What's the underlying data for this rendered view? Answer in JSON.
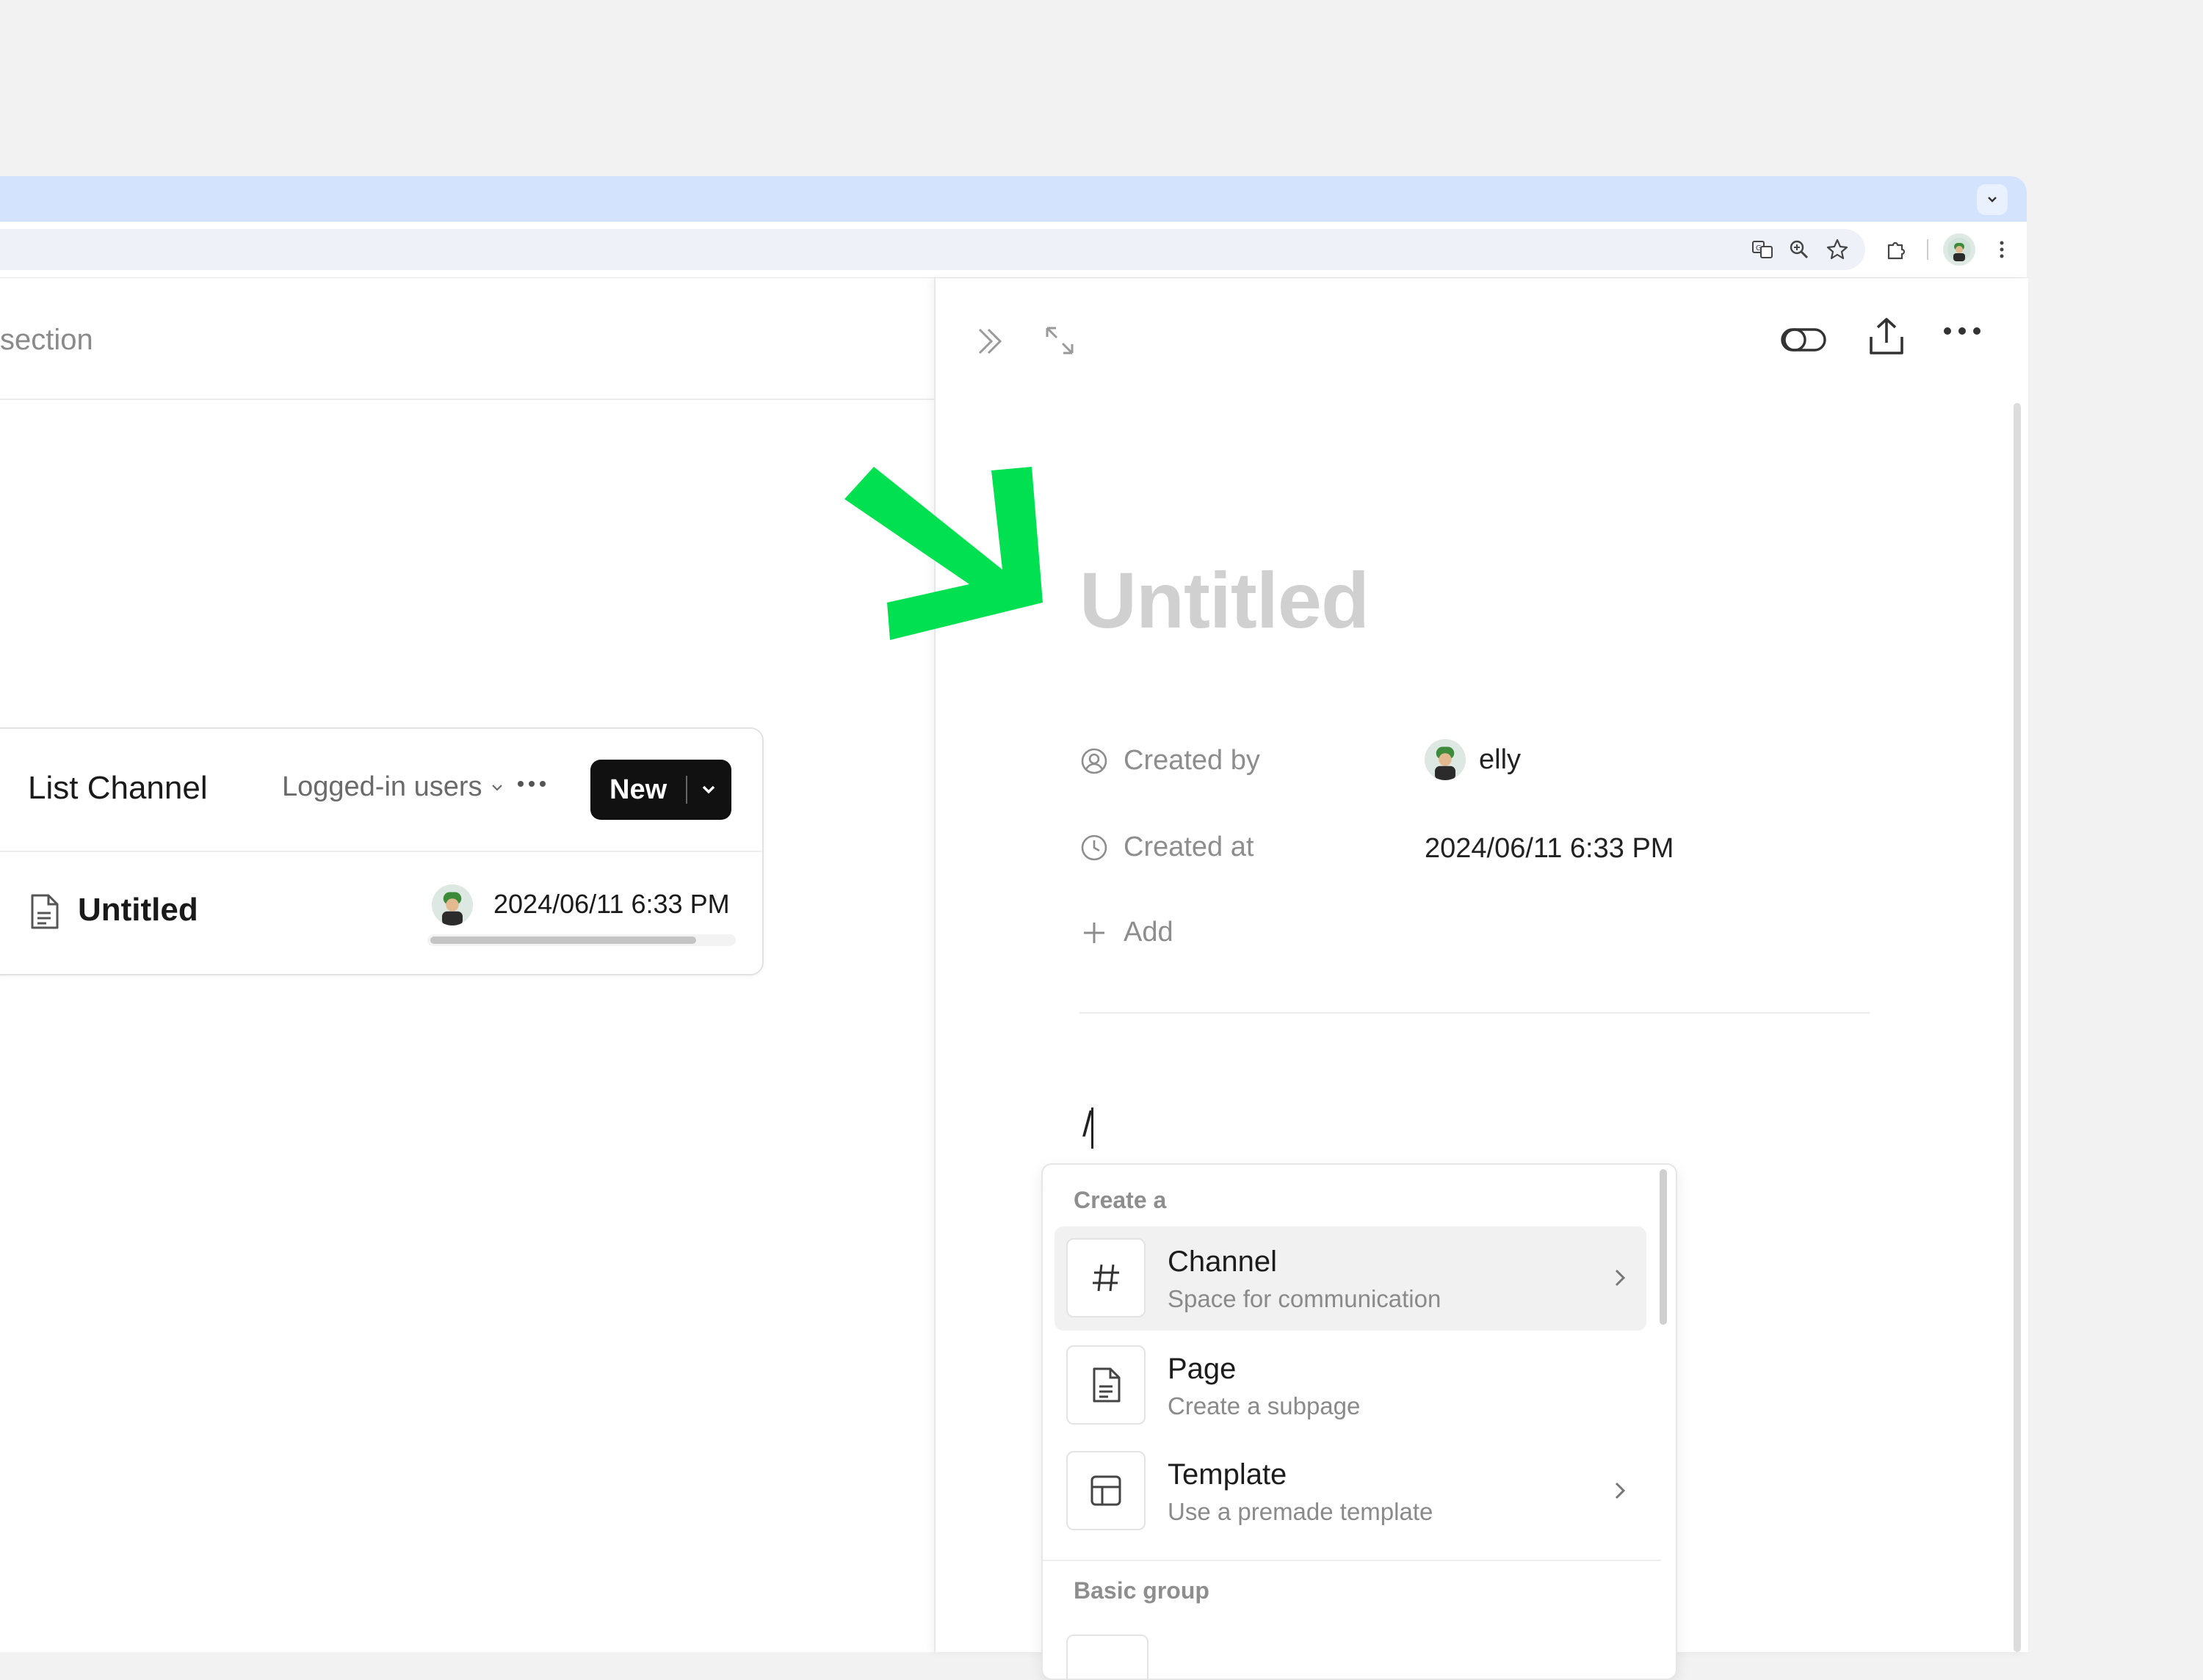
{
  "left": {
    "section_label": "section",
    "card": {
      "title": "List Channel",
      "audience": "Logged-in users",
      "new_label": "New",
      "row": {
        "title": "Untitled",
        "date": "2024/06/11 6:33 PM"
      }
    }
  },
  "panel": {
    "page_title": "Untitled",
    "props": [
      {
        "label": "Created by",
        "value": "elly"
      },
      {
        "label": "Created at",
        "value": "2024/06/11 6:33 PM"
      }
    ],
    "add_label": "Add",
    "slash_text": "/"
  },
  "slash_menu": {
    "groups": [
      "Create a",
      "Basic group"
    ],
    "items": [
      {
        "title": "Channel",
        "subtitle": "Space for communication",
        "icon": "hash-icon",
        "has_submenu": true
      },
      {
        "title": "Page",
        "subtitle": "Create a subpage",
        "icon": "document-icon",
        "has_submenu": false
      },
      {
        "title": "Template",
        "subtitle": "Use a premade template",
        "icon": "template-icon",
        "has_submenu": true
      }
    ]
  },
  "colors": {
    "annotation_arrow": "#00e050",
    "tab_strip": "#d3e3fd",
    "new_button": "#111111"
  }
}
